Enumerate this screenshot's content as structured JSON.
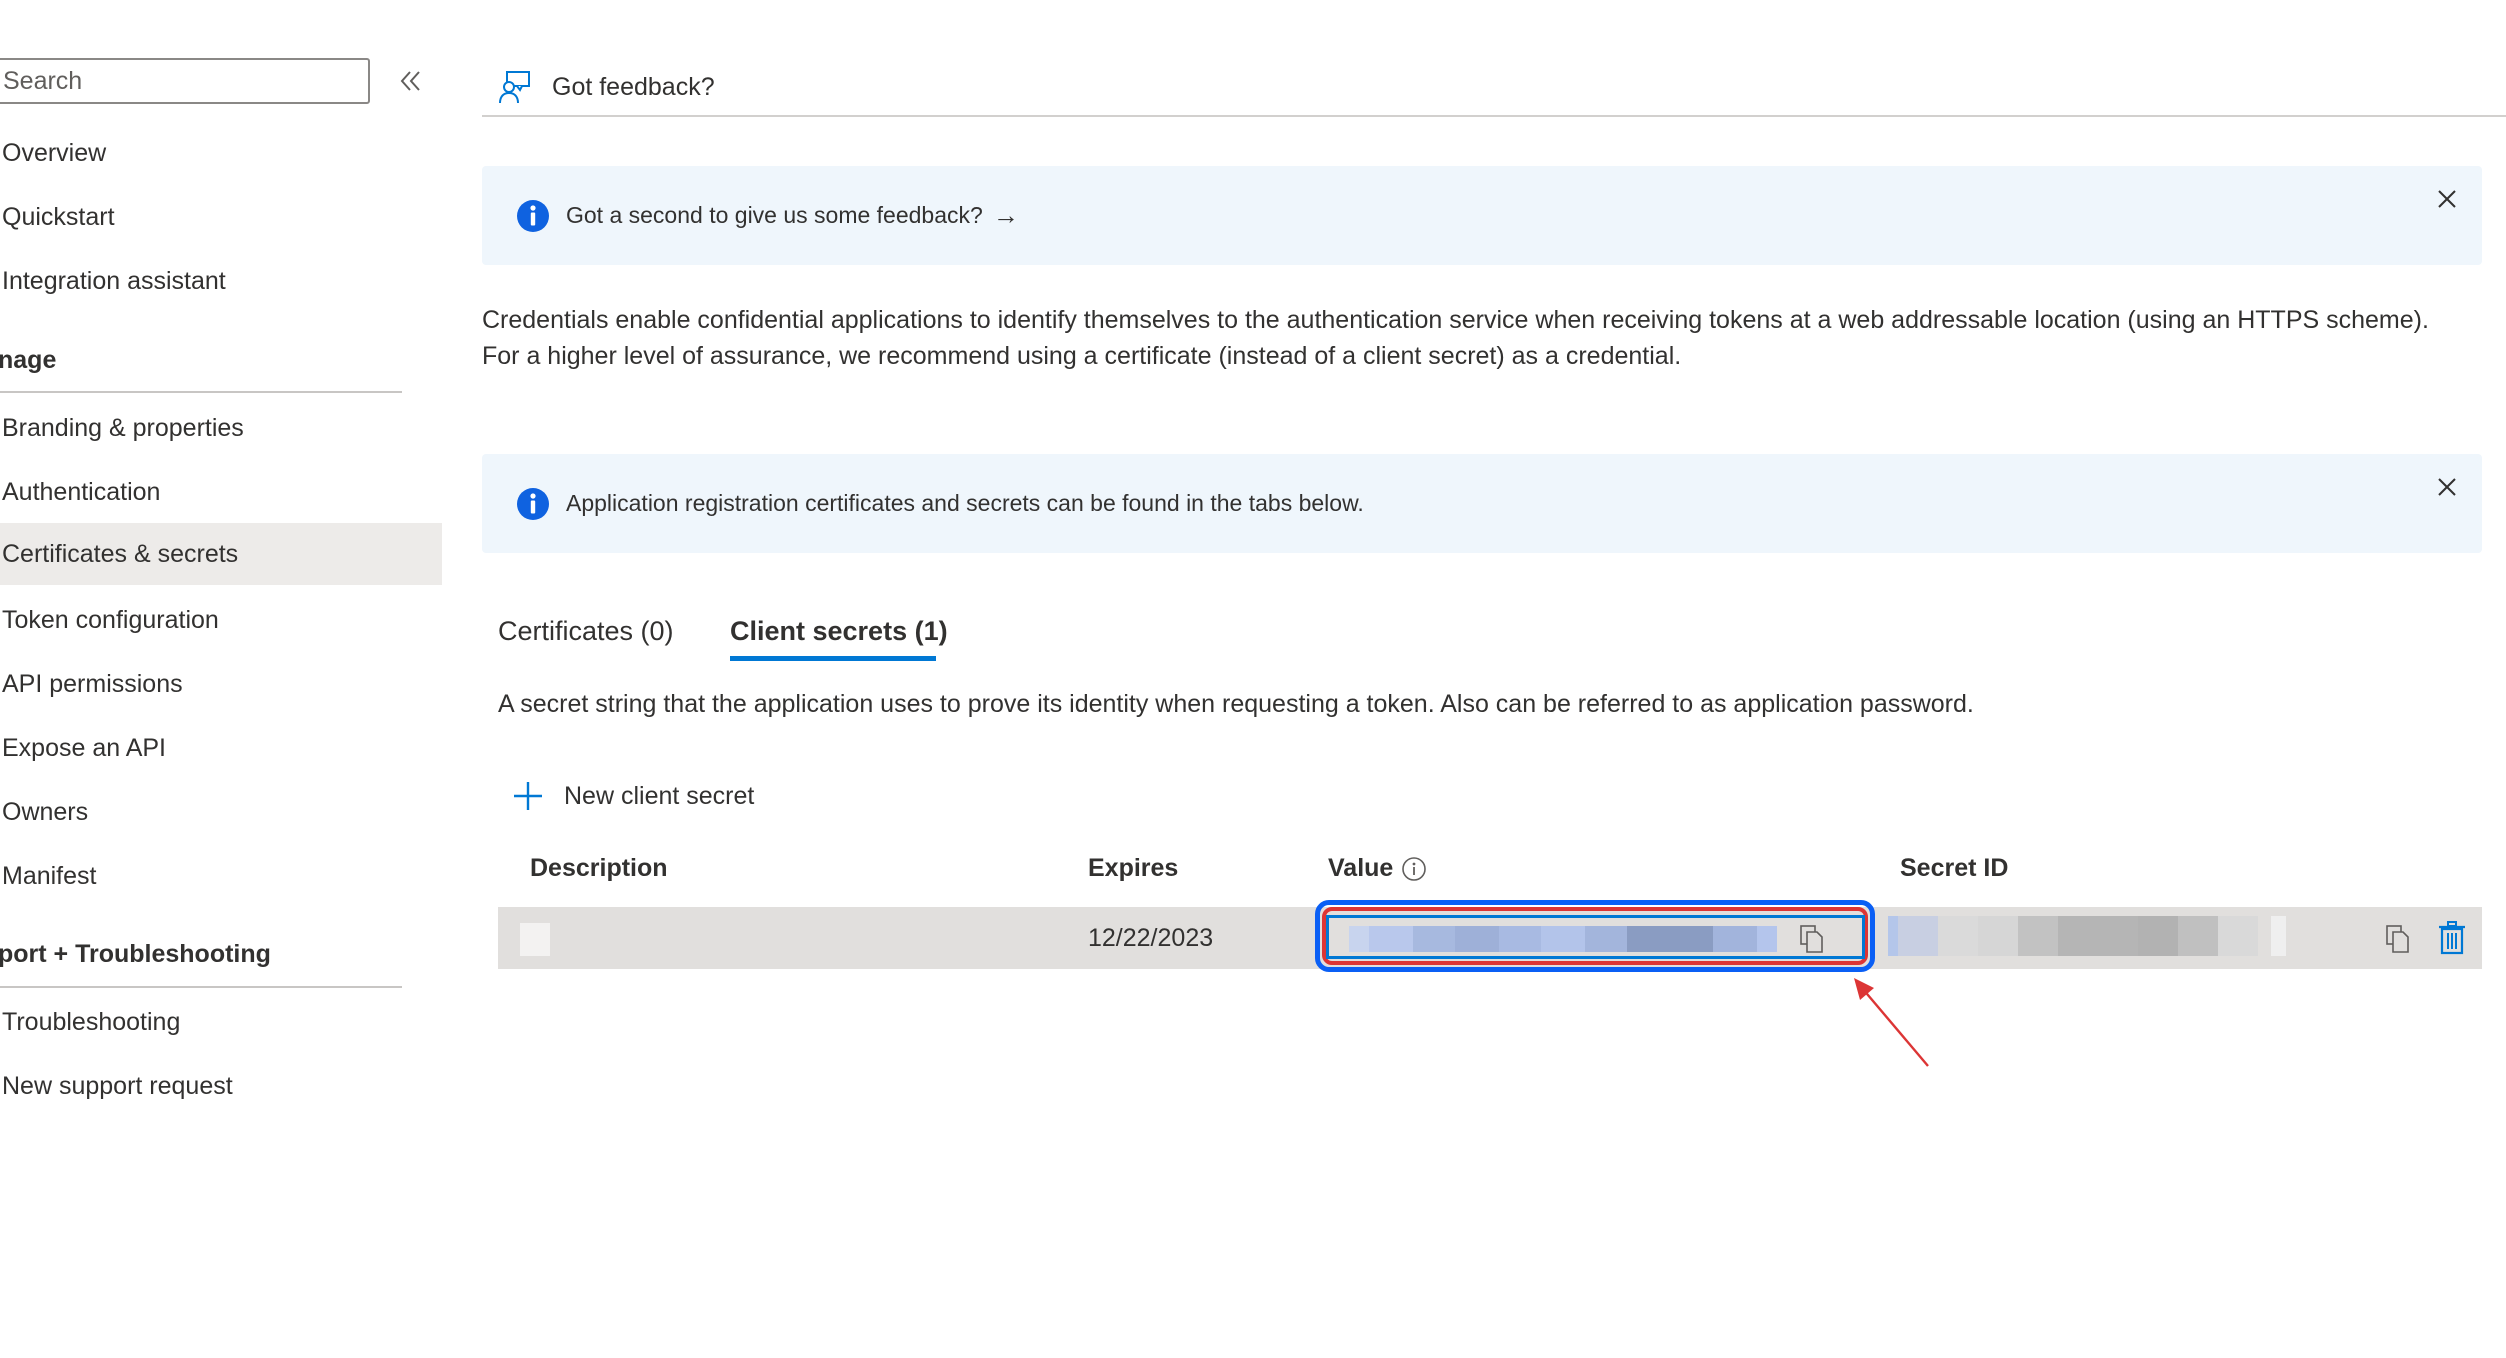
{
  "sidebar": {
    "search_placeholder": "Search",
    "collapse_label": "«",
    "items_top": [
      {
        "label": "Overview"
      },
      {
        "label": "Quickstart"
      },
      {
        "label": "Integration assistant"
      }
    ],
    "manage_header": "nage",
    "manage_items": [
      {
        "label": "Branding & properties"
      },
      {
        "label": "Authentication"
      },
      {
        "label": "Certificates & secrets",
        "selected": true
      },
      {
        "label": "Token configuration"
      },
      {
        "label": "API permissions"
      },
      {
        "label": "Expose an API"
      },
      {
        "label": "Owners"
      },
      {
        "label": "Manifest"
      }
    ],
    "support_header": "port + Troubleshooting",
    "support_items": [
      {
        "label": "Troubleshooting"
      },
      {
        "label": "New support request"
      }
    ]
  },
  "header": {
    "feedback_label": "Got feedback?"
  },
  "banners": [
    {
      "text": "Got a second to give us some feedback?",
      "arrow": "→",
      "icon": "info-icon"
    },
    {
      "text": "Application registration certificates and secrets can be found in the tabs below.",
      "icon": "info-icon"
    }
  ],
  "description": "Credentials enable confidential applications to identify themselves to the authentication service when receiving tokens at a web addressable location (using an HTTPS scheme). For a higher level of assurance, we recommend using a certificate (instead of a client secret) as a credential.",
  "tabs": [
    {
      "label": "Certificates (0)",
      "active": false
    },
    {
      "label": "Client secrets (1)",
      "active": true
    }
  ],
  "client_secrets": {
    "subtitle": "A secret string that the application uses to prove its identity when requesting a token. Also can be referred to as application password.",
    "new_button_label": "New client secret",
    "columns": [
      "Description",
      "Expires",
      "Value",
      "Secret ID"
    ],
    "rows": [
      {
        "description": "",
        "expires": "12/22/2023",
        "value": "[redacted]",
        "secret_id": "[redacted]"
      }
    ]
  },
  "colors": {
    "accent": "#0078d4",
    "banner_bg": "#eff6fc",
    "selected_bg": "#edebe9",
    "row_bg": "#e1dfdd",
    "annotation_red": "#dc3535",
    "annotation_blue": "#0a5ff5"
  }
}
